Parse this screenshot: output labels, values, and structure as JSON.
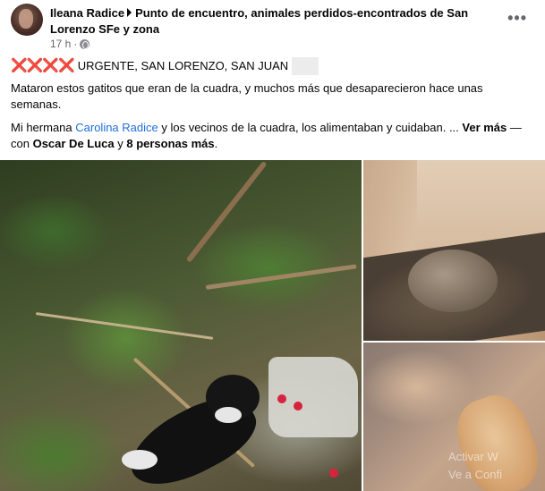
{
  "post": {
    "author": "Ileana Radice",
    "group": "Punto de encuentro, animales perdidos-encontrados de San Lorenzo SFe y zona",
    "time": "17 h",
    "more_label": "•••"
  },
  "content": {
    "xmarks": "❌❌❌❌",
    "headline": "URGENTE, SAN LORENZO, SAN JUAN",
    "paragraph1": "Mataron estos gatitos  que eran de la cuadra, y muchos más que desaparecieron hace unas semanas.",
    "p2_prefix": " Mi hermana ",
    "p2_link": "Carolina Radice",
    "p2_middle": " y los vecinos de la cuadra, los alimentaban y cuidaban. ... ",
    "see_more": "Ver más",
    "p2_tag_prefix": " — con ",
    "tag1": "Oscar De Luca",
    "tag_join": " y ",
    "tag2": "8 personas más",
    "tag_end": "."
  },
  "photos": {
    "watermark_line1": "Activar W",
    "watermark_line2": "Ve a Confi"
  },
  "colors": {
    "link": "#216fdb",
    "meta": "#65676b",
    "x_red": "#e0245e"
  },
  "icons": [
    "globe-icon",
    "more-options-icon",
    "arrow-right-icon"
  ]
}
